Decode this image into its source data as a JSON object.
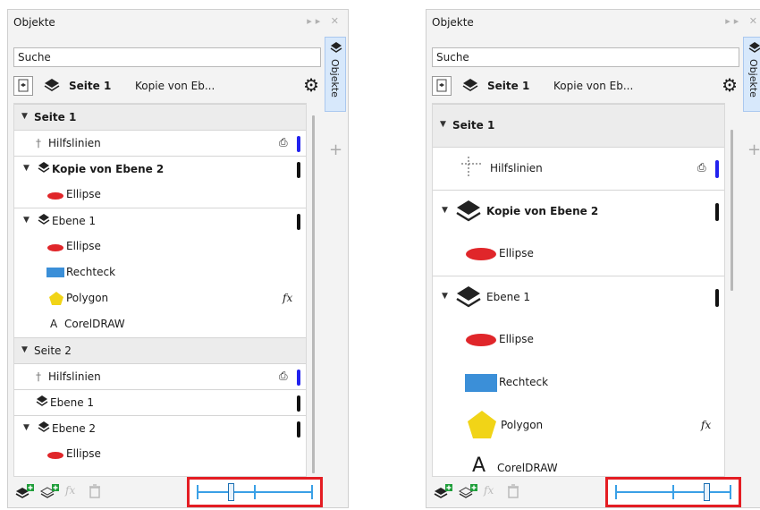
{
  "left": {
    "title": "Objekte",
    "search": "Suche",
    "page_name": "Seite 1",
    "layer_name": "Kopie von Eb...",
    "side_tab": "Objekte",
    "rows": [
      {
        "label": "Seite 1",
        "bold": true,
        "header": true
      },
      {
        "label": "Hilfslinien",
        "print": "⎙",
        "bar": "blue"
      },
      {
        "label": "Kopie von Ebene 2",
        "bold": true,
        "bar": "black"
      },
      {
        "label": "Ellipse"
      },
      {
        "label": "Ebene 1",
        "bar": "black"
      },
      {
        "label": "Ellipse"
      },
      {
        "label": "Rechteck"
      },
      {
        "label": "Polygon",
        "fx": "fx"
      },
      {
        "label": "CorelDRAW"
      },
      {
        "label": "Seite 2",
        "header": true
      },
      {
        "label": "Hilfslinien",
        "print": "⎙",
        "bar": "blue"
      },
      {
        "label": "Ebene 1",
        "bar": "black"
      },
      {
        "label": "Ebene 2",
        "bar": "black"
      },
      {
        "label": "Ellipse"
      }
    ],
    "zoom_level": 0.3
  },
  "right": {
    "title": "Objekte",
    "search": "Suche",
    "page_name": "Seite 1",
    "layer_name": "Kopie von Eb...",
    "side_tab": "Objekte",
    "rows": [
      {
        "label": "Seite 1",
        "bold": true,
        "header": true
      },
      {
        "label": "Hilfslinien",
        "print": "⎙",
        "bar": "blue"
      },
      {
        "label": "Kopie von Ebene 2",
        "bold": true,
        "bar": "black"
      },
      {
        "label": "Ellipse"
      },
      {
        "label": "Ebene 1",
        "bar": "black"
      },
      {
        "label": "Ellipse"
      },
      {
        "label": "Rechteck"
      },
      {
        "label": "Polygon",
        "fx": "fx"
      },
      {
        "label": "CorelDRAW"
      }
    ],
    "zoom_level": 0.8
  },
  "colors": {
    "ellipse": "#e0262a",
    "rect": "#3b8fd8",
    "polygon": "#f1d417",
    "highlight": "#e41d23",
    "slider": "#3aa0e6"
  },
  "icons": [
    "layer-icon",
    "gear-icon",
    "guides-icon",
    "print-icon",
    "fx-icon",
    "new-layer-icon",
    "new-master-layer-icon",
    "effect-icon",
    "delete-icon",
    "text-icon"
  ]
}
